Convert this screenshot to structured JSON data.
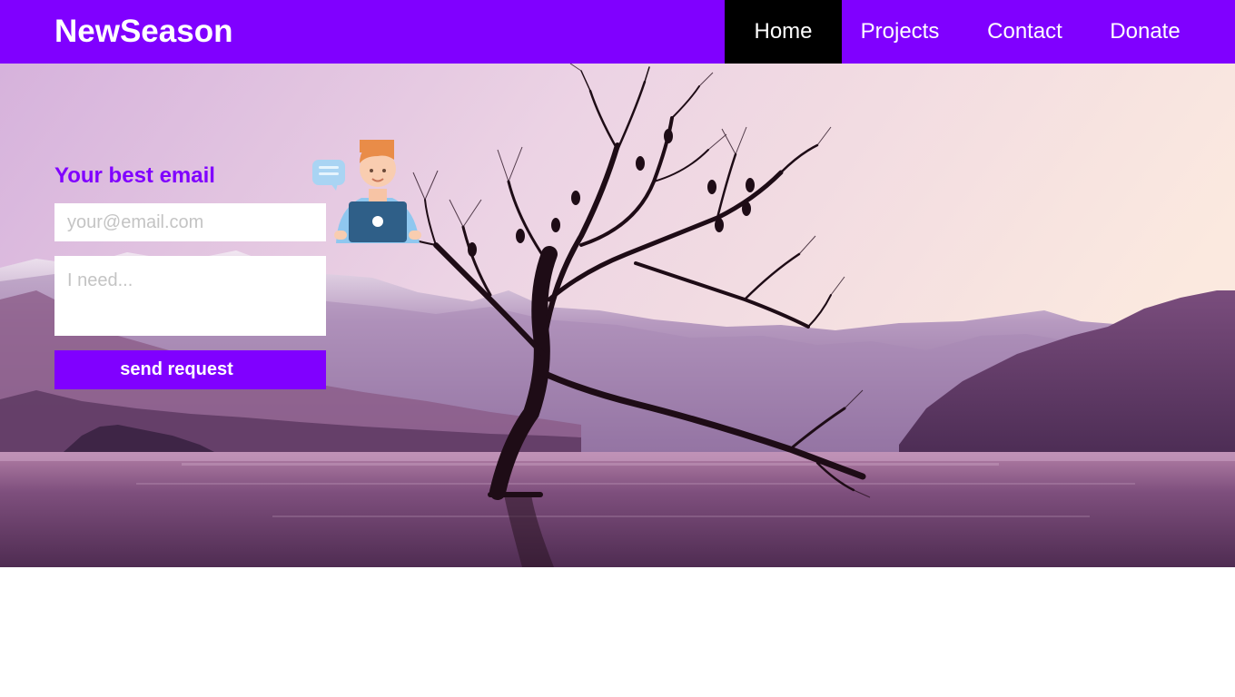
{
  "navbar": {
    "brand": "NewSeason",
    "items": [
      {
        "label": "Home",
        "active": true
      },
      {
        "label": "Projects",
        "active": false
      },
      {
        "label": "Contact",
        "active": false
      },
      {
        "label": "Donate",
        "active": false
      }
    ]
  },
  "contact_form": {
    "title": "Your best email",
    "email_placeholder": "your@email.com",
    "email_value": "",
    "need_placeholder": "I need...",
    "need_value": "",
    "submit_label": "send request"
  },
  "hero": {
    "image": "lake-tree-mountains-icon",
    "illustration": "person-laptop-chat-icon"
  },
  "colors": {
    "brand": "#8000ff",
    "active_nav": "#000000",
    "text_light": "#ffffff"
  }
}
